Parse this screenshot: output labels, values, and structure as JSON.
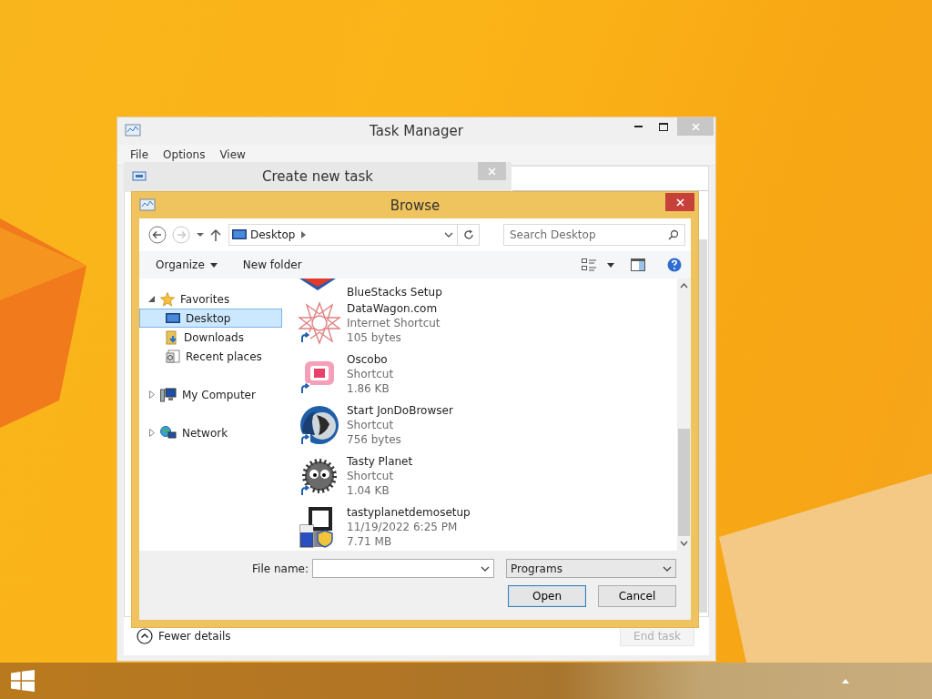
{
  "task_manager": {
    "title": "Task Manager",
    "menu": [
      "File",
      "Options",
      "View"
    ],
    "fewer_details": "Fewer details",
    "end_task": {
      "label": "End task",
      "disabled": true
    }
  },
  "create_task": {
    "title": "Create new task"
  },
  "browse": {
    "title": "Browse",
    "back": {
      "disabled": false
    },
    "forward": {
      "disabled": true
    },
    "address": "Desktop",
    "search": {
      "placeholder": "Search Desktop"
    },
    "toolbar": [
      "Organize",
      "New folder"
    ],
    "nav": [
      {
        "label": "Favorites",
        "kind": "star",
        "expanded": true,
        "children": [
          {
            "label": "Desktop",
            "kind": "desktop",
            "selected": true
          },
          {
            "label": "Downloads",
            "kind": "download",
            "selected": false
          },
          {
            "label": "Recent places",
            "kind": "recent",
            "selected": false
          }
        ]
      },
      {
        "label": "My Computer",
        "kind": "computer",
        "expanded": false
      },
      {
        "label": "Network",
        "kind": "network",
        "expanded": false
      }
    ],
    "files": [
      {
        "name": "BlueStacks Setup",
        "kind": "layers",
        "shortcut": false
      },
      {
        "name": "DataWagon.com",
        "kind": "star",
        "shortcut": true,
        "details": [
          "Internet Shortcut",
          "105 bytes"
        ]
      },
      {
        "name": "Oscobo",
        "kind": "square",
        "shortcut": true,
        "details": [
          "Shortcut",
          "1.86 KB"
        ]
      },
      {
        "name": "Start JonDoBrowser",
        "kind": "globe",
        "shortcut": true,
        "details": [
          "Shortcut",
          "756 bytes"
        ]
      },
      {
        "name": "Tasty Planet",
        "kind": "fuzzball",
        "shortcut": true,
        "details": [
          "Shortcut",
          "1.04 KB"
        ]
      },
      {
        "name": "tastyplanetdemosetup",
        "kind": "installer",
        "shortcut": false,
        "details": [
          "11/19/2022 6:25 PM",
          "7.71 MB"
        ]
      }
    ],
    "file_name_label": "File name:",
    "filter": "Programs",
    "buttons": [
      {
        "label": "Open",
        "default": true
      },
      {
        "label": "Cancel",
        "default": false
      }
    ]
  }
}
